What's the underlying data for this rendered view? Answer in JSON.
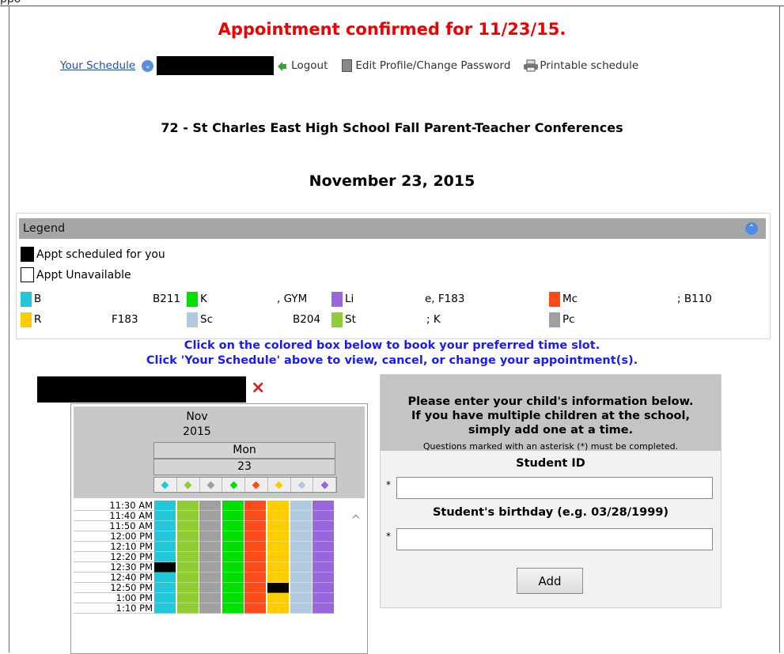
{
  "page_header_word": "ppo",
  "confirmation": "Appointment confirmed for 11/23/15.",
  "toolbar": {
    "your_schedule": "Your Schedule",
    "logout": "Logout",
    "edit_profile": "Edit Profile/Change Password",
    "printable": "Printable schedule"
  },
  "event_title": "72 - St Charles East High School Fall Parent-Teacher Conferences",
  "event_date": "November 23, 2015",
  "legend": {
    "title": "Legend",
    "keys": [
      {
        "label": "Appt scheduled for you"
      },
      {
        "label": "Appt Unavailable"
      }
    ],
    "row1": [
      {
        "a": "B",
        "b": "B211",
        "color": "#22c8d8"
      },
      {
        "a": "K",
        "b": ", GYM",
        "color": "#00e000"
      },
      {
        "a": "Li",
        "b": "e, F183",
        "color": "#9966dd"
      },
      {
        "a": "Mc",
        "b": "; B110",
        "color": "#ff4a1a"
      }
    ],
    "row2": [
      {
        "a": "R",
        "b": "F183",
        "color": "#ffcc00"
      },
      {
        "a": "Sc",
        "b": "B204",
        "color": "#b0c8e0"
      },
      {
        "a": "St",
        "b": "; K",
        "color": "#90cc33"
      },
      {
        "a": "Pc",
        "b": "",
        "color": "#a0a0a0"
      }
    ]
  },
  "instructions": [
    "Click on the colored box below to book your preferred time slot.",
    "Click 'Your Schedule' above to view, cancel, or change your appointment(s)."
  ],
  "calendar": {
    "month": "Nov",
    "year": "2015",
    "weekday": "Mon",
    "day": "23",
    "columns": [
      "#22c8d8",
      "#90cc33",
      "#a0a0a0",
      "#00e000",
      "#ff4a1a",
      "#ffcc00",
      "#b0c8e0",
      "#9966dd"
    ],
    "times": [
      "11:30 AM",
      "11:40 AM",
      "11:50 AM",
      "12:00 PM",
      "12:10 PM",
      "12:20 PM",
      "12:30 PM",
      "12:40 PM",
      "12:50 PM",
      "1:00 PM",
      "1:10 PM"
    ],
    "booked": [
      {
        "slot": 6,
        "col": 0
      },
      {
        "slot": 8,
        "col": 5
      }
    ],
    "booked_color": "#000000"
  },
  "form": {
    "message": [
      "Please enter your child's information below.",
      "If you have multiple children at the school,",
      "simply add one at a time."
    ],
    "note": "Questions marked with an asterisk (*) must be completed.",
    "student_id_label": "Student ID",
    "birthday_label": "Student's birthday (e.g. 03/28/1999)",
    "asterisk": "*",
    "add_button": "Add"
  },
  "icons": {
    "remove": "×",
    "collapse": "⌃",
    "scroll_up": "^",
    "schedule_arrow": "⌄"
  }
}
